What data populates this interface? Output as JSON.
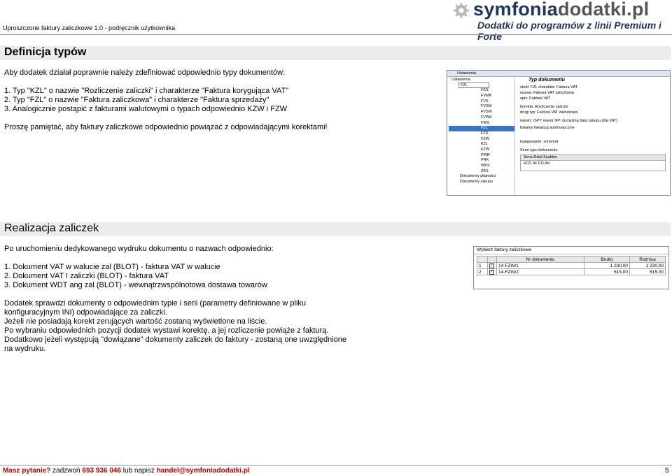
{
  "header": {
    "doc_title": "Uproszczone faktury zaliczkowe 1.0  - podręcznik użytkownika",
    "brand_part1": "symfonia",
    "brand_part2": "dodatki.pl",
    "tagline": "Dodatki do programów z linii Premium i Forte"
  },
  "section1": {
    "title": "Definicja typów",
    "intro": "Aby dodatek działał poprawnie należy zdefiniować odpowiednio typy dokumentów:",
    "items": [
      "1. Typ \"KZL\" o nazwie \"Rozliczenie zaliczki\" i charakterze \"Faktura korygująca VAT\"",
      "2. Typ \"FZL\" o nazwie \"Faktura zaliczkowa\" i charakterze \"Faktura sprzedaży\"",
      "3. Analogicznie postąpić z fakturami walutowymi o typach odpowiednio KZW i FZW"
    ],
    "note": "Proszę pamiętać, aby faktury zaliczkowe odpowiednio powiązać z odpowiadającymi korektami!"
  },
  "screenshot1": {
    "toolbar": "Ustawienia",
    "tree_root": "Ustawienia",
    "combo_value": "FZL",
    "tree_items": [
      "FKS",
      "FVMK",
      "FVS",
      "FVSM",
      "FVSW",
      "FVWK",
      "FWS",
      "FZL",
      "FZS",
      "FZW",
      "KZL",
      "KZW",
      "PWR",
      "PRK",
      "WKS",
      "ZKS"
    ],
    "selected_item": "FZL",
    "tree_footer1": "Dokumenty płatności",
    "tree_footer2": "Dokumenty zakupu",
    "panel_title": "Typ dokumentu",
    "fields": [
      "skrót:   FZL       charakter:   Faktura VAT",
      "nazwa:   Faktura VAT zaliczkowa",
      "opis:    Faktura VAT",
      "korekta:     Rozliczenie zaliczki",
      "drugi typ:   Faktura VAT zaliczkowa",
      "rejestr:   rSPY      rejestr NP:     domyślna data zakupu (dla VAT)",
      "fiskalny        fiskalizuj automatycznie",
      "księgowanie:    schemat",
      "Serie typu dokumentu",
      "Seria    Dział    Szablon",
      "sFZL                 lik FZL/lin"
    ]
  },
  "section2": {
    "title": "Realizacja zaliczek",
    "intro": "Po uruchomieniu dedykowanego wydruku dokumentu o nazwach odpowiednio:",
    "items": [
      "1. Dokument VAT w walucie zal (BLOT) - faktura VAT w walucie",
      "2. Dokument VAT I zaliczki (BLOT) - faktura VAT",
      "3. Dokument WDT ang zal (BLOT) - wewnątrzwspólnotowa dostawa towarów"
    ],
    "para_lines": [
      "Dodatek sprawdzi dokumenty o odpowiednim typie i serii (parametry definiowane w pliku",
      "konfiguracyjnym INI) odpowiadające za zaliczki.",
      "Jeżeli nie posiadają korekt zerujących wartość zostaną wyświetlone na liście.",
      "Po wybraniu odpowiednich pozycji dodatek wystawi korektę, a jej rozliczenie powiąże z fakturą.",
      "Dodatkowo jeżeli występują \"dowiązane\" dokumenty zaliczek do faktury - zostaną one uwzględnione",
      "na wydruku."
    ]
  },
  "screenshot2": {
    "caption": "Wybierz faktury zaliczkowe",
    "columns": [
      "",
      "",
      "Nr dokumentu",
      "Brutto",
      "Rożnica"
    ],
    "rows": [
      {
        "n": "1",
        "chk": "✓",
        "doc": "14-FZW/1",
        "brutto": "1 230,00",
        "roznica": "1 230,00"
      },
      {
        "n": "2",
        "chk": "✓",
        "doc": "14-FZW/2",
        "brutto": "615,00",
        "roznica": "615,00"
      }
    ]
  },
  "footer": {
    "q": "Masz pytanie?",
    "call": " zadzwoń ",
    "phone": "693 936 046",
    "or": " lub napisz ",
    "email": "handel@symfoniadodatki.pl",
    "page": "5"
  }
}
